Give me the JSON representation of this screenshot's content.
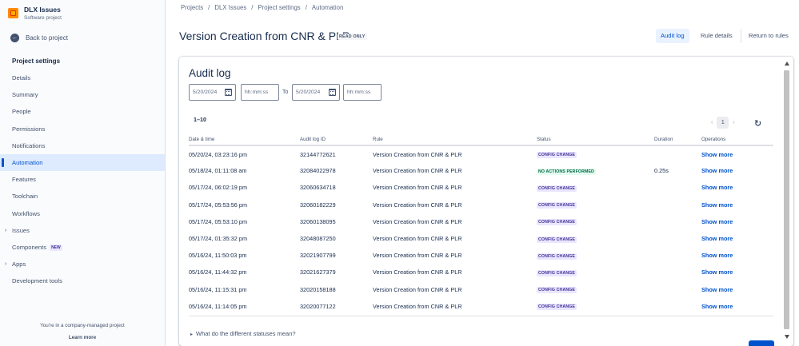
{
  "project": {
    "name": "DLX Issues",
    "type": "Software project"
  },
  "sidebar": {
    "back_label": "Back to project",
    "heading": "Project settings",
    "items": [
      {
        "label": "Details"
      },
      {
        "label": "Summary"
      },
      {
        "label": "People"
      },
      {
        "label": "Permissions"
      },
      {
        "label": "Notifications"
      },
      {
        "label": "Automation",
        "active": true
      },
      {
        "label": "Features"
      },
      {
        "label": "Toolchain"
      },
      {
        "label": "Workflows"
      },
      {
        "label": "Issues",
        "expandable": true
      },
      {
        "label": "Components",
        "badge": "NEW"
      },
      {
        "label": "Apps",
        "expandable": true
      },
      {
        "label": "Development tools"
      }
    ],
    "footer_text": "You're in a company-managed project",
    "learn_more": "Learn more"
  },
  "breadcrumb": [
    "Projects",
    "DLX Issues",
    "Project settings",
    "Automation"
  ],
  "header": {
    "title": "Version Creation from CNR & PLR",
    "badge": "READ ONLY",
    "audit_log_label": "Audit log",
    "rule_details_label": "Rule details",
    "return_label": "Return to rules"
  },
  "audit": {
    "title": "Audit log",
    "from_date": "5/20/2024",
    "to_label": "To",
    "to_date": "5/20/2024",
    "time_placeholder": "hh:mm:ss",
    "range_label": "1–10",
    "current_page": "1",
    "columns": [
      "Date & time",
      "Audit log ID",
      "Rule",
      "Status",
      "Duration",
      "Operations"
    ],
    "rows": [
      {
        "date": "05/20/24, 03:23:16 pm",
        "id": "32144772621",
        "rule": "Version Creation from CNR & PLR",
        "status": "CONFIG CHANGE",
        "status_type": "config",
        "duration": "",
        "op": "Show more"
      },
      {
        "date": "05/18/24, 01:11:08 am",
        "id": "32084022978",
        "rule": "Version Creation from CNR & PLR",
        "status": "NO ACTIONS PERFORMED",
        "status_type": "noaction",
        "duration": "0.25s",
        "op": "Show more"
      },
      {
        "date": "05/17/24, 06:02:19 pm",
        "id": "32060634718",
        "rule": "Version Creation from CNR & PLR",
        "status": "CONFIG CHANGE",
        "status_type": "config",
        "duration": "",
        "op": "Show more"
      },
      {
        "date": "05/17/24, 05:53:56 pm",
        "id": "32060182229",
        "rule": "Version Creation from CNR & PLR",
        "status": "CONFIG CHANGE",
        "status_type": "config",
        "duration": "",
        "op": "Show more"
      },
      {
        "date": "05/17/24, 05:53:10 pm",
        "id": "32060138095",
        "rule": "Version Creation from CNR & PLR",
        "status": "CONFIG CHANGE",
        "status_type": "config",
        "duration": "",
        "op": "Show more"
      },
      {
        "date": "05/17/24, 01:35:32 pm",
        "id": "32048087250",
        "rule": "Version Creation from CNR & PLR",
        "status": "CONFIG CHANGE",
        "status_type": "config",
        "duration": "",
        "op": "Show more"
      },
      {
        "date": "05/16/24, 11:50:03 pm",
        "id": "32021907799",
        "rule": "Version Creation from CNR & PLR",
        "status": "CONFIG CHANGE",
        "status_type": "config",
        "duration": "",
        "op": "Show more"
      },
      {
        "date": "05/16/24, 11:44:32 pm",
        "id": "32021627379",
        "rule": "Version Creation from CNR & PLR",
        "status": "CONFIG CHANGE",
        "status_type": "config",
        "duration": "",
        "op": "Show more"
      },
      {
        "date": "05/16/24, 11:15:31 pm",
        "id": "32020158188",
        "rule": "Version Creation from CNR & PLR",
        "status": "CONFIG CHANGE",
        "status_type": "config",
        "duration": "",
        "op": "Show more"
      },
      {
        "date": "05/16/24, 11:14:05 pm",
        "id": "32020077122",
        "rule": "Version Creation from CNR & PLR",
        "status": "CONFIG CHANGE",
        "status_type": "config",
        "duration": "",
        "op": "Show more"
      }
    ],
    "faq_label": "What do the different statuses mean?"
  },
  "icons": {
    "project": "project-logo-icon",
    "back": "arrow-left-circle-icon",
    "calendar": "calendar-icon",
    "prev": "chevron-left-icon",
    "next": "chevron-right-icon",
    "refresh": "refresh-icon",
    "expand": "chevron-right-icon"
  },
  "colors": {
    "accent": "#0052cc",
    "active_bg": "#deebff",
    "config_text": "#403294",
    "config_bg": "#eae6ff",
    "noaction_text": "#006644",
    "noaction_bg": "#e3fcef"
  }
}
